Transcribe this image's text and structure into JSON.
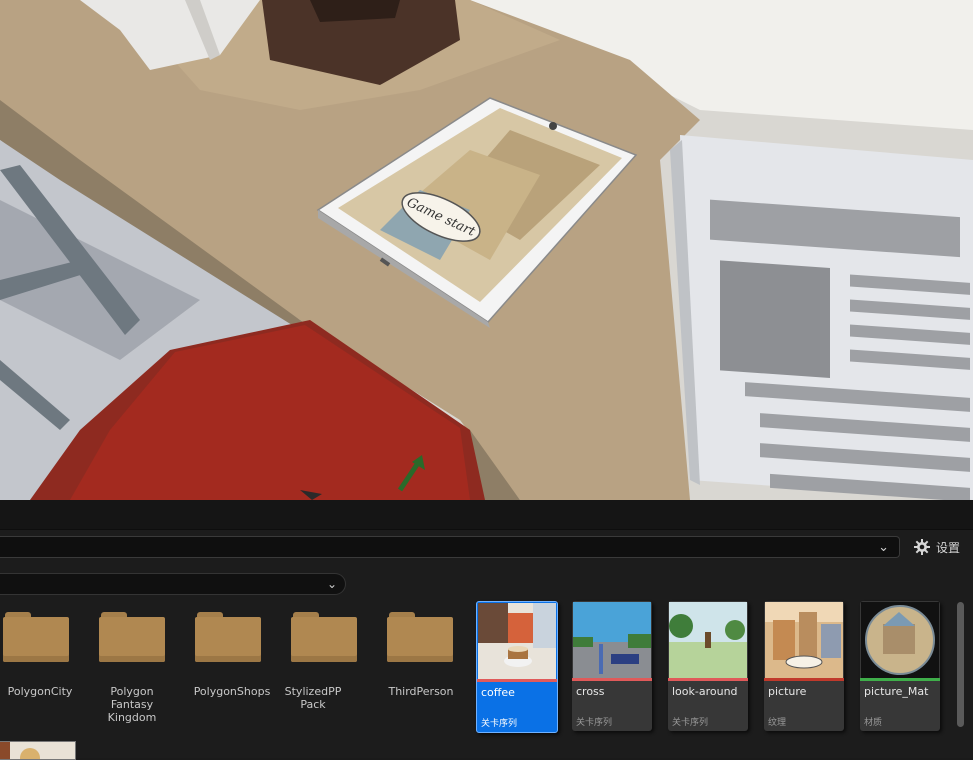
{
  "viewport": {
    "tablet_screen_text": "Game start"
  },
  "content_browser": {
    "settings_label": "设置",
    "folders": [
      {
        "name": "PolygonCity"
      },
      {
        "name": "Polygon Fantasy Kingdom"
      },
      {
        "name": "PolygonShops"
      },
      {
        "name": "StylizedPP Pack"
      },
      {
        "name": "ThirdPerson"
      }
    ],
    "assets": [
      {
        "name": "coffee",
        "type": "关卡序列",
        "selected": true,
        "bar_color": "#e05a5a"
      },
      {
        "name": "cross",
        "type": "关卡序列",
        "selected": false,
        "bar_color": "#e05a5a"
      },
      {
        "name": "look-around",
        "type": "关卡序列",
        "selected": false,
        "bar_color": "#e05a5a"
      },
      {
        "name": "picture",
        "type": "纹理",
        "selected": false,
        "bar_color": "#c0392b"
      },
      {
        "name": "picture_Mat",
        "type": "材质",
        "selected": false,
        "bar_color": "#3fae4a"
      }
    ]
  }
}
